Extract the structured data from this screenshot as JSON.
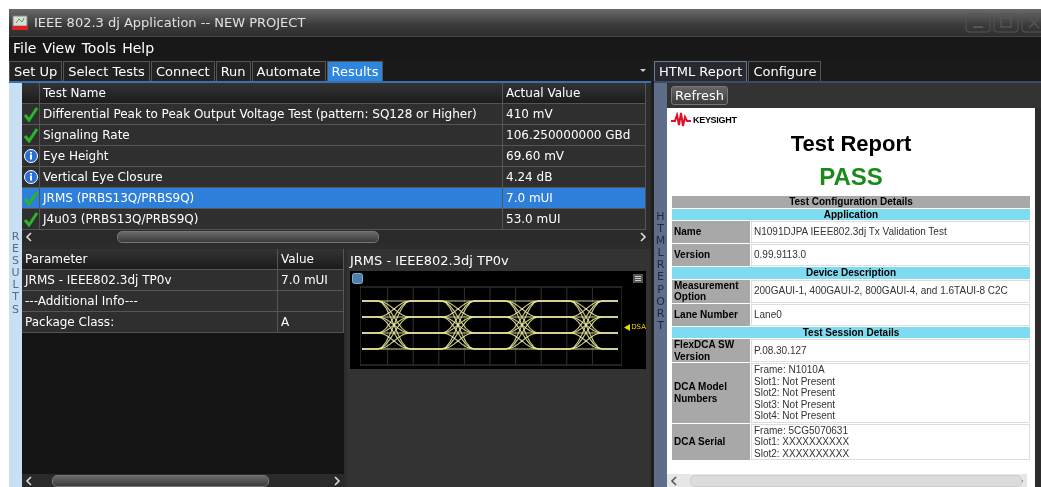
{
  "window": {
    "title": "IEEE 802.3 dj Application -- NEW PROJECT"
  },
  "menu": [
    "File",
    "View",
    "Tools",
    "Help"
  ],
  "tabs": [
    {
      "label": "Set Up",
      "selected": false
    },
    {
      "label": "Select Tests",
      "selected": false
    },
    {
      "label": "Connect",
      "selected": false
    },
    {
      "label": "Run",
      "selected": false
    },
    {
      "label": "Automate",
      "selected": false
    },
    {
      "label": "Results",
      "selected": true
    }
  ],
  "results_label": "RESULTS",
  "results_table": {
    "columns": [
      "Test Name",
      "Actual Value"
    ],
    "rows": [
      {
        "kind": "pass",
        "name": "Differential Peak to Peak Output Voltage Test (pattern: SQ128 or Higher)",
        "value": "410 mV",
        "selected": false
      },
      {
        "kind": "pass",
        "name": "Signaling Rate",
        "value": "106.250000000 GBd",
        "selected": false
      },
      {
        "kind": "info",
        "name": "Eye Height",
        "value": "69.60 mV",
        "selected": false
      },
      {
        "kind": "info",
        "name": "Vertical Eye Closure",
        "value": "4.24 dB",
        "selected": false
      },
      {
        "kind": "pass",
        "name": "JRMS (PRBS13Q/PRBS9Q)",
        "value": "7.0 mUI",
        "selected": true
      },
      {
        "kind": "pass",
        "name": "J4u03 (PRBS13Q/PRBS9Q)",
        "value": "53.0 mUI",
        "selected": false
      }
    ]
  },
  "parameter_table": {
    "columns": [
      "Parameter",
      "Value"
    ],
    "rows": [
      {
        "parameter": "JRMS - IEEE802.3dj TP0v",
        "value": "7.0 mUI"
      },
      {
        "parameter": "---Additional Info---",
        "value": ""
      },
      {
        "parameter": "Package Class:",
        "value": "A"
      }
    ]
  },
  "eye_panel": {
    "title": "JRMS - IEEE802.3dj TP0v",
    "marker": "DSA"
  },
  "report_tabs": [
    {
      "label": "HTML Report",
      "selected": true
    },
    {
      "label": "Configure",
      "selected": false
    }
  ],
  "report_label": "HTML REPORT",
  "refresh_button": "Refresh",
  "report": {
    "logo": "KEYSIGHT",
    "title": "Test Report",
    "result": "PASS",
    "rows": [
      {
        "kind": "main_header",
        "text": "Test Configuration Details"
      },
      {
        "kind": "section",
        "text": "Application"
      },
      {
        "kind": "field",
        "label": "Name",
        "lines": [
          "N1091DJPA IEEE802.3dj Tx Validation Test"
        ]
      },
      {
        "kind": "field",
        "label": "Version",
        "lines": [
          "0.99.9113.0"
        ]
      },
      {
        "kind": "section",
        "text": "Device Description"
      },
      {
        "kind": "field",
        "label": "Measurement Option",
        "lines": [
          "200GAUI-1, 400GAUI-2, 800GAUI-4, and 1.6TAUI-8 C2C"
        ]
      },
      {
        "kind": "field",
        "label": "Lane Number",
        "lines": [
          "Lane0"
        ]
      },
      {
        "kind": "section",
        "text": "Test Session Details"
      },
      {
        "kind": "field",
        "label": "FlexDCA SW Version",
        "lines": [
          "P.08.30.127"
        ]
      },
      {
        "kind": "field",
        "label": "DCA Model Numbers",
        "lines": [
          "Frame: N1010A",
          "Slot1: Not Present",
          "Slot2: Not Present",
          "Slot3: Not Present",
          "Slot4: Not Present"
        ]
      },
      {
        "kind": "field",
        "label": "DCA Serial",
        "lines": [
          "Frame: 5CG5070631",
          "Slot1: XXXXXXXXXX",
          "Slot2: XXXXXXXXXX"
        ]
      }
    ]
  }
}
